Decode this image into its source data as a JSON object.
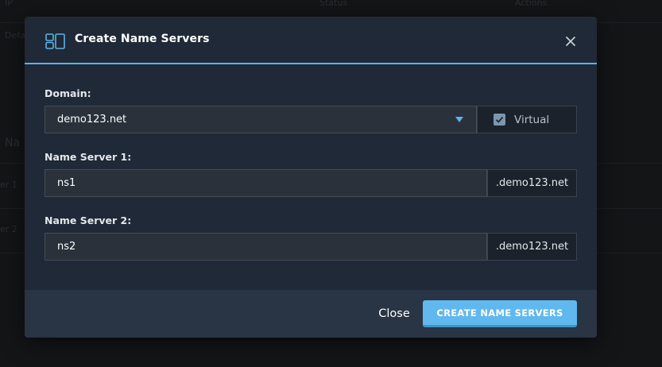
{
  "background": {
    "header_cells": [
      "IP",
      "Status",
      "Actions"
    ],
    "row_fragments": [
      "Default",
      "Na",
      "er 1",
      "er 2"
    ]
  },
  "dialog": {
    "title": "Create Name Servers",
    "icon": "name-servers-icon",
    "domain": {
      "label": "Domain:",
      "value": "demo123.net",
      "virtual_label": "Virtual",
      "virtual_checked": true
    },
    "ns1": {
      "label": "Name Server 1:",
      "value": "ns1",
      "suffix": ".demo123.net"
    },
    "ns2": {
      "label": "Name Server 2:",
      "value": "ns2",
      "suffix": ".demo123.net"
    },
    "footer": {
      "close_label": "Close",
      "submit_label": "CREATE NAME SERVERS"
    }
  },
  "colors": {
    "accent": "#5cb3e6",
    "primary_button": "#60b8ee",
    "modal_bg": "#1f2937",
    "footer_bg": "#293445"
  }
}
